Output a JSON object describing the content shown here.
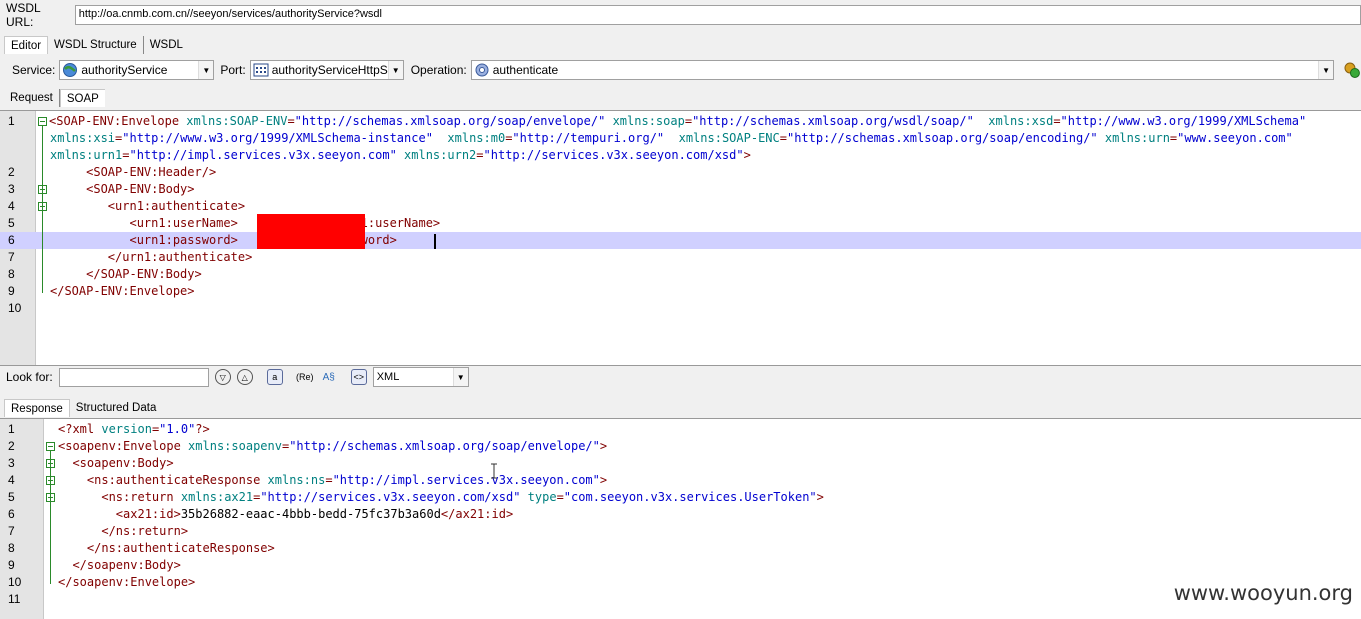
{
  "wsdl": {
    "label": "WSDL URL:",
    "url": "http://oa.cnmb.com.cn//seeyon/services/authorityService?wsdl"
  },
  "editor_tabs": [
    "Editor",
    "WSDL Structure",
    "WSDL"
  ],
  "service": {
    "service_label": "Service:",
    "service_value": "authorityService",
    "port_label": "Port:",
    "port_value": "authorityServiceHttpSoap",
    "operation_label": "Operation:",
    "operation_value": "authenticate",
    "icons": {
      "service": "globe-icon",
      "port": "port-grid-icon",
      "operation": "gear-icon",
      "run": "run-icon"
    }
  },
  "request_tabs": [
    "Request",
    "SOAP"
  ],
  "request": {
    "line_numbers": [
      "1",
      "2",
      "3",
      "4",
      "5",
      "6",
      "7",
      "8",
      "9",
      "10"
    ],
    "lines": [
      {
        "indent": "",
        "parts": [
          [
            "tag",
            "<SOAP-ENV:Envelope "
          ],
          [
            "attr",
            "xmlns:SOAP-ENV"
          ],
          [
            "tag",
            "="
          ],
          [
            "val",
            "\"http://schemas.xmlsoap.org/soap/envelope/\""
          ],
          [
            "tag",
            " "
          ],
          [
            "attr",
            "xmlns:soap"
          ],
          [
            "tag",
            "="
          ],
          [
            "val",
            "\"http://schemas.xmlsoap.org/wsdl/soap/\""
          ],
          [
            "tag",
            "  "
          ],
          [
            "attr",
            "xmlns:xsd"
          ],
          [
            "tag",
            "="
          ],
          [
            "val",
            "\"http://www.w3.org/1999/XMLSchema\""
          ]
        ]
      },
      {
        "indent": "",
        "parts": [
          [
            "attr",
            "xmlns:xsi"
          ],
          [
            "tag",
            "="
          ],
          [
            "val",
            "\"http://www.w3.org/1999/XMLSchema-instance\""
          ],
          [
            "tag",
            "  "
          ],
          [
            "attr",
            "xmlns:m0"
          ],
          [
            "tag",
            "="
          ],
          [
            "val",
            "\"http://tempuri.org/\""
          ],
          [
            "tag",
            "  "
          ],
          [
            "attr",
            "xmlns:SOAP-ENC"
          ],
          [
            "tag",
            "="
          ],
          [
            "val",
            "\"http://schemas.xmlsoap.org/soap/encoding/\""
          ],
          [
            "tag",
            " "
          ],
          [
            "attr",
            "xmlns:urn"
          ],
          [
            "tag",
            "="
          ],
          [
            "val",
            "\"www.seeyon.com\""
          ]
        ]
      },
      {
        "indent": "",
        "parts": [
          [
            "attr",
            "xmlns:urn1"
          ],
          [
            "tag",
            "="
          ],
          [
            "val",
            "\"http://impl.services.v3x.seeyon.com\""
          ],
          [
            "tag",
            " "
          ],
          [
            "attr",
            "xmlns:urn2"
          ],
          [
            "tag",
            "="
          ],
          [
            "val",
            "\"http://services.v3x.seeyon.com/xsd\""
          ],
          [
            "tag",
            ">"
          ]
        ]
      },
      {
        "indent": "     ",
        "parts": [
          [
            "tag",
            "<SOAP-ENV:Header/>"
          ]
        ]
      },
      {
        "indent": "     ",
        "parts": [
          [
            "tag",
            "<SOAP-ENV:Body>"
          ]
        ]
      },
      {
        "indent": "        ",
        "parts": [
          [
            "tag",
            "<urn1:authenticate>"
          ]
        ]
      },
      {
        "indent": "           ",
        "parts": [
          [
            "tag",
            "<urn1:userName>"
          ],
          [
            "txtc",
            "            "
          ],
          [
            "tag",
            "</urn1:userName>"
          ]
        ]
      },
      {
        "indent": "           ",
        "parts": [
          [
            "tag",
            "<urn1:password>"
          ],
          [
            "txtc",
            "             "
          ],
          [
            "tag",
            "password>"
          ]
        ]
      },
      {
        "indent": "        ",
        "parts": [
          [
            "tag",
            "</urn1:authenticate>"
          ]
        ]
      },
      {
        "indent": "     ",
        "parts": [
          [
            "tag",
            "</SOAP-ENV:Body>"
          ]
        ]
      },
      {
        "indent": "",
        "parts": [
          [
            "tag",
            "</SOAP-ENV:Envelope>"
          ]
        ]
      },
      {
        "indent": "",
        "parts": []
      }
    ]
  },
  "look_for": {
    "label": "Look for:",
    "value": "",
    "format": "XML"
  },
  "response_tabs": [
    "Response",
    "Structured Data"
  ],
  "response": {
    "line_numbers": [
      "1",
      "2",
      "3",
      "4",
      "5",
      "6",
      "7",
      "8",
      "9",
      "10",
      "11"
    ],
    "lines": [
      {
        "indent": "",
        "parts": [
          [
            "tag",
            "<?xml "
          ],
          [
            "attr",
            "version"
          ],
          [
            "tag",
            "="
          ],
          [
            "val",
            "\"1.0\""
          ],
          [
            "tag",
            "?>"
          ]
        ]
      },
      {
        "indent": "",
        "parts": [
          [
            "tag",
            "<soapenv:Envelope "
          ],
          [
            "attr",
            "xmlns:soapenv"
          ],
          [
            "tag",
            "="
          ],
          [
            "val",
            "\"http://schemas.xmlsoap.org/soap/envelope/\""
          ],
          [
            "tag",
            ">"
          ]
        ]
      },
      {
        "indent": "  ",
        "parts": [
          [
            "tag",
            "<soapenv:Body>"
          ]
        ]
      },
      {
        "indent": "    ",
        "parts": [
          [
            "tag",
            "<ns:authenticateResponse "
          ],
          [
            "attr",
            "xmlns:ns"
          ],
          [
            "tag",
            "="
          ],
          [
            "val",
            "\"http://impl.services.v3x.seeyon.com\""
          ],
          [
            "tag",
            ">"
          ]
        ]
      },
      {
        "indent": "      ",
        "parts": [
          [
            "tag",
            "<ns:return "
          ],
          [
            "attr",
            "xmlns:ax21"
          ],
          [
            "tag",
            "="
          ],
          [
            "val",
            "\"http://services.v3x.seeyon.com/xsd\""
          ],
          [
            "tag",
            " "
          ],
          [
            "attr",
            "type"
          ],
          [
            "tag",
            "="
          ],
          [
            "val",
            "\"com.seeyon.v3x.services.UserToken\""
          ],
          [
            "tag",
            ">"
          ]
        ]
      },
      {
        "indent": "        ",
        "parts": [
          [
            "tag",
            "<ax21:id>"
          ],
          [
            "txtc",
            "35b26882-eaac-4bbb-bedd-75fc37b3a60d"
          ],
          [
            "tag",
            "</ax21:id>"
          ]
        ]
      },
      {
        "indent": "      ",
        "parts": [
          [
            "tag",
            "</ns:return>"
          ]
        ]
      },
      {
        "indent": "    ",
        "parts": [
          [
            "tag",
            "</ns:authenticateResponse>"
          ]
        ]
      },
      {
        "indent": "  ",
        "parts": [
          [
            "tag",
            "</soapenv:Body>"
          ]
        ]
      },
      {
        "indent": "",
        "parts": [
          [
            "tag",
            "</soapenv:Envelope>"
          ]
        ]
      },
      {
        "indent": "",
        "parts": []
      }
    ]
  },
  "watermark": "www.wooyun.org"
}
